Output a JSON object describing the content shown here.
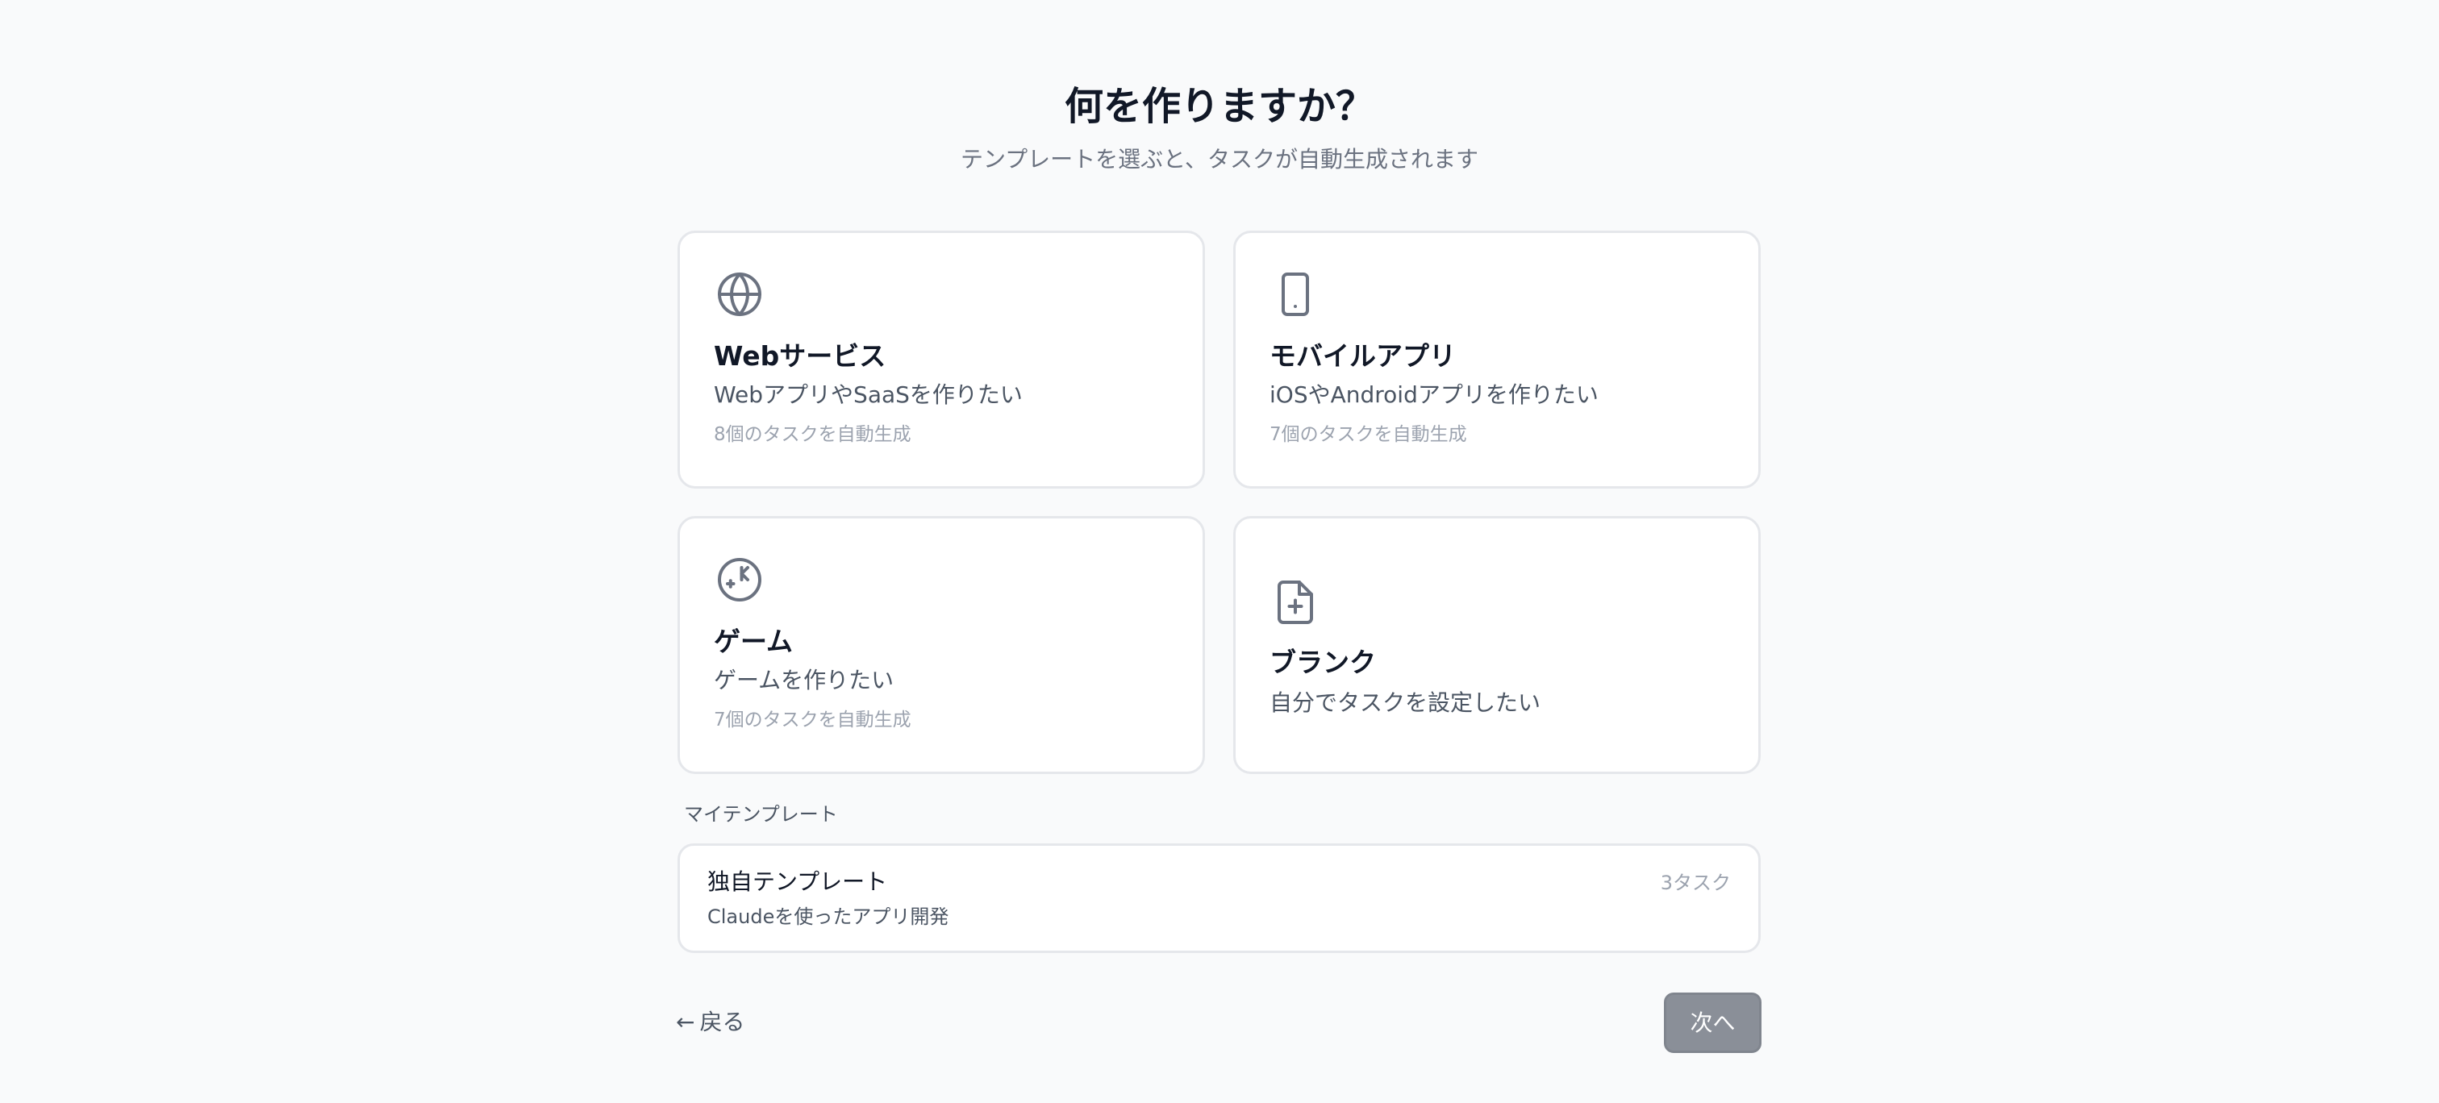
{
  "header": {
    "title": "何を作りますか？",
    "subtitle": "テンプレートを選ぶと、タスクが自動生成されます"
  },
  "templates": [
    {
      "icon": "globe-icon",
      "name": "Webサービス",
      "description": "WebアプリやSaaSを作りたい",
      "task_note": "8個のタスクを自動生成"
    },
    {
      "icon": "smartphone-icon",
      "name": "モバイルアプリ",
      "description": "iOSやAndroidアプリを作りたい",
      "task_note": "7個のタスクを自動生成"
    },
    {
      "icon": "gamepad-icon",
      "name": "ゲーム",
      "description": "ゲームを作りたい",
      "task_note": "7個のタスクを自動生成"
    },
    {
      "icon": "file-plus-icon",
      "name": "ブランク",
      "description": "自分でタスクを設定したい"
    }
  ],
  "my_templates": {
    "section_label": "マイテンプレート",
    "items": [
      {
        "name": "独自テンプレート",
        "description": "Claudeを使ったアプリ開発",
        "task_count": "3タスク"
      }
    ]
  },
  "footer": {
    "back_arrow": "←",
    "back_label": "戻る",
    "next_label": "次へ"
  },
  "colors": {
    "background": "#f9fafb",
    "card_border": "#e5e7eb",
    "next_button": "#8a8f98",
    "text_primary": "#111827",
    "text_secondary": "#4b5563",
    "text_muted": "#9ca3af"
  }
}
